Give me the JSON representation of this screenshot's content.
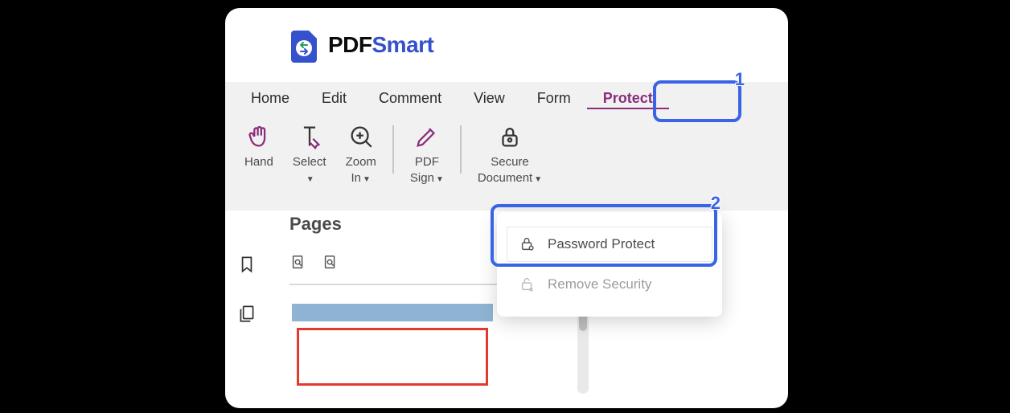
{
  "brand": {
    "pdf": "PDF",
    "smart": "Smart"
  },
  "menu": {
    "items": [
      "Home",
      "Edit",
      "Comment",
      "View",
      "Form",
      "Protect"
    ],
    "active_index": 5
  },
  "ribbon": {
    "hand": "Hand",
    "select": "Select",
    "zoom_line1": "Zoom",
    "zoom_line2": "In",
    "sign_line1": "PDF",
    "sign_line2": "Sign",
    "secure_line1": "Secure",
    "secure_line2": "Document"
  },
  "pages_panel": {
    "title": "Pages"
  },
  "dropdown": {
    "password_protect": "Password Protect",
    "remove_security": "Remove Security"
  },
  "callouts": {
    "one": "1",
    "two": "2"
  }
}
